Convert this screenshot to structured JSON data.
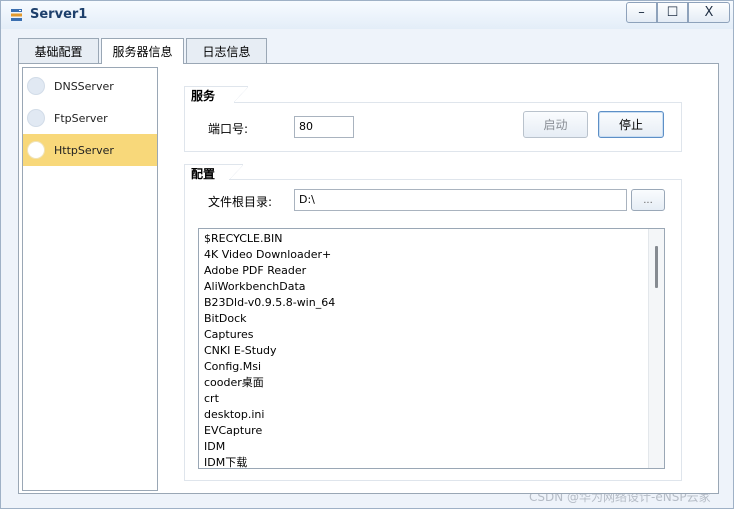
{
  "window": {
    "title": "Server1",
    "controls": {
      "minimize": "–",
      "maximize": "☐",
      "close": "X"
    }
  },
  "tabs": [
    {
      "label": "基础配置"
    },
    {
      "label": "服务器信息",
      "active": true
    },
    {
      "label": "日志信息"
    }
  ],
  "sidebar": {
    "items": [
      {
        "label": "DNSServer"
      },
      {
        "label": "FtpServer"
      },
      {
        "label": "HttpServer",
        "selected": true
      }
    ]
  },
  "service": {
    "section_title": "服务",
    "port_label": "端口号:",
    "port_value": "80",
    "start_label": "启动",
    "stop_label": "停止"
  },
  "config": {
    "section_title": "配置",
    "root_dir_label": "文件根目录:",
    "root_dir_value": "D:\\",
    "browse_label": "...",
    "files": [
      "$RECYCLE.BIN",
      "4K Video Downloader+",
      "Adobe PDF Reader",
      "AliWorkbenchData",
      "B23Dld-v0.9.5.8-win_64",
      "BitDock",
      "Captures",
      "CNKI E-Study",
      "Config.Msi",
      "cooder桌面",
      "crt",
      "desktop.ini",
      "EVCapture",
      "IDM",
      "IDM下载"
    ]
  },
  "watermark": "CSDN @华为网络设计-eNSP云家",
  "colors": {
    "selected_item": "#f8d87a",
    "title_text": "#1d3f6b"
  }
}
